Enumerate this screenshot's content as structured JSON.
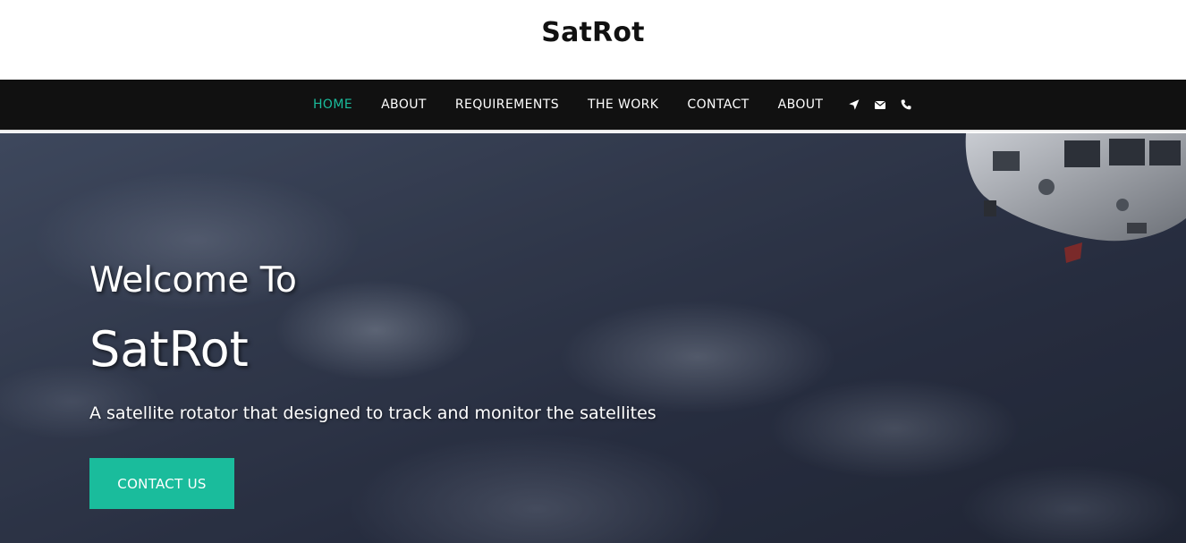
{
  "header": {
    "site_title": "SatRot"
  },
  "nav": {
    "items": [
      {
        "label": "HOME",
        "active": true
      },
      {
        "label": "ABOUT",
        "active": false
      },
      {
        "label": "REQUIREMENTS",
        "active": false
      },
      {
        "label": "THE WORK",
        "active": false
      },
      {
        "label": "CONTACT",
        "active": false
      },
      {
        "label": "ABOUT",
        "active": false
      }
    ],
    "icons": [
      "location-arrow-icon",
      "envelope-icon",
      "phone-icon"
    ]
  },
  "hero": {
    "welcome": "Welcome To",
    "brand": "SatRot",
    "tagline": "A satellite rotator that designed to track and monitor the satellites",
    "cta_label": "CONTACT US"
  },
  "colors": {
    "accent": "#1abc9c",
    "navbar_bg": "#111111",
    "text_light": "#ffffff",
    "title_text": "#111111"
  }
}
